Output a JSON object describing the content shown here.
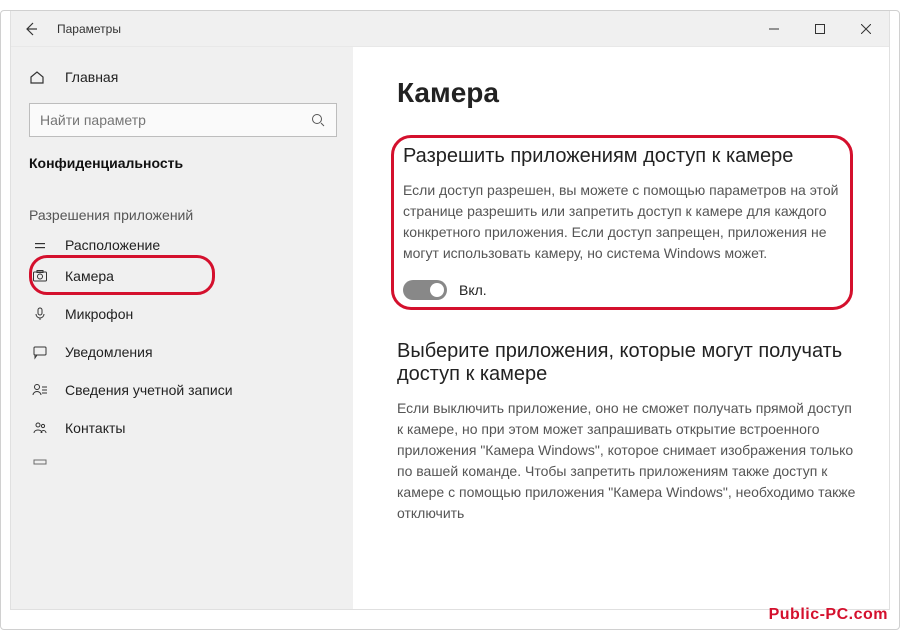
{
  "titlebar": {
    "title": "Параметры"
  },
  "sidebar": {
    "home_label": "Главная",
    "search_placeholder": "Найти параметр",
    "section_title": "Конфиденциальность",
    "group_label": "Разрешения приложений",
    "items": [
      {
        "label": "Расположение",
        "icon": "location-icon"
      },
      {
        "label": "Камера",
        "icon": "camera-icon"
      },
      {
        "label": "Микрофон",
        "icon": "microphone-icon"
      },
      {
        "label": "Уведомления",
        "icon": "notifications-icon"
      },
      {
        "label": "Сведения учетной записи",
        "icon": "account-info-icon"
      },
      {
        "label": "Контакты",
        "icon": "contacts-icon"
      }
    ]
  },
  "main": {
    "page_title": "Камера",
    "section1": {
      "heading": "Разрешить приложениям доступ к камере",
      "body": "Если доступ разрешен, вы можете с помощью параметров на этой странице разрешить или запретить доступ к камере для каждого конкретного приложения. Если доступ запрещен, приложения не могут использовать камеру, но система Windows может.",
      "toggle_label": "Вкл."
    },
    "section2": {
      "heading": "Выберите приложения, которые могут получать доступ к камере",
      "body": "Если выключить приложение, оно не сможет получать прямой доступ к камере, но при этом может запрашивать открытие встроенного приложения \"Камера Windows\", которое снимает изображения только по вашей команде. Чтобы запретить приложениям также доступ к камере с помощью приложения \"Камера Windows\", необходимо также отключить"
    }
  },
  "watermark": "Public-PC.com"
}
